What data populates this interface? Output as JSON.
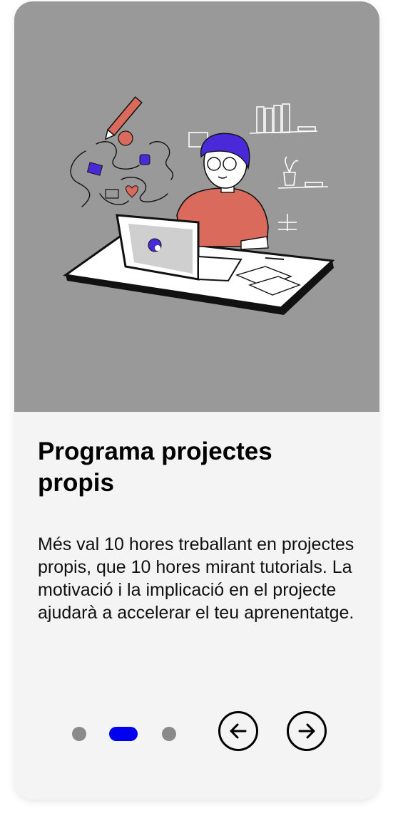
{
  "slide": {
    "title": "Programa projectes propis",
    "description": "Més val 10 hores treballant en projectes propis, que 10 hores mirant tutorials. La motivació i la implicació en el projecte ajudarà a accelerar el teu aprenentatge.",
    "image_icon": "person-working-at-laptop-illustration"
  },
  "pagination": {
    "total": 3,
    "current": 2,
    "active_color": "#0000ee",
    "inactive_color": "#8a8a8a"
  },
  "navigation": {
    "prev_icon": "arrow-left-icon",
    "next_icon": "arrow-right-icon"
  },
  "colors": {
    "hero_background": "#999999",
    "card_background": "#f4f4f4",
    "hair": "#4a2ad8",
    "shirt": "#d96a5c"
  }
}
